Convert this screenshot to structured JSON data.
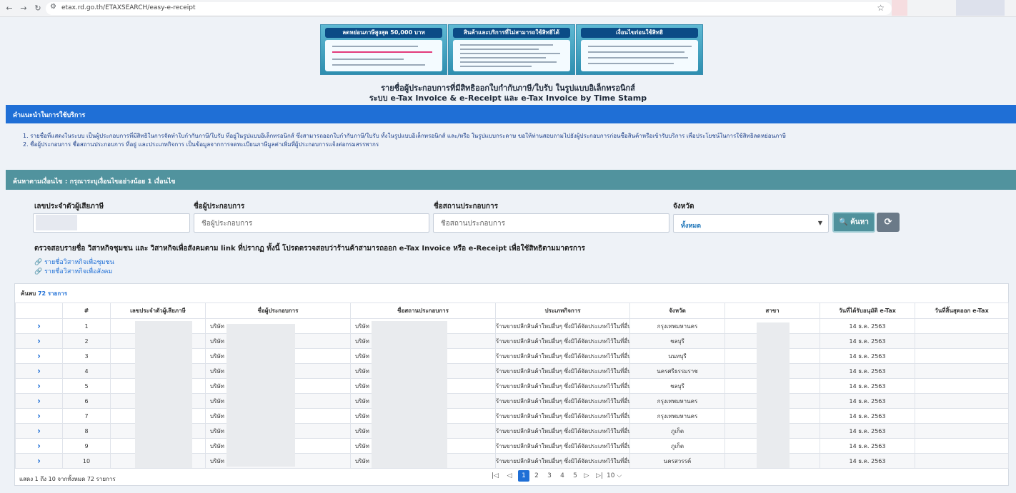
{
  "browser": {
    "url": "etax.rd.go.th/ETAXSEARCH/easy-e-receipt"
  },
  "banners": [
    {
      "title": "ลดหย่อนภาษีสูงสุด 50,000 บาท"
    },
    {
      "title": "สินค้าและบริการที่ไม่สามารถใช้สิทธิได้"
    },
    {
      "title": "เงื่อนไขก่อนใช้สิทธิ"
    }
  ],
  "headline": {
    "line1": "รายชื่อผู้ประกอบการที่มีสิทธิออกใบกำกับภาษี/ใบรับ ในรูปแบบอิเล็กทรอนิกส์",
    "line2": "ระบบ e-Tax Invoice & e-Receipt และ e-Tax Invoice by Time Stamp"
  },
  "info": {
    "heading": "คำแนะนำในการใช้บริการ",
    "item1": "1. รายชื่อที่แสดงในระบบ เป็นผู้ประกอบการที่มีสิทธิในการจัดทำใบกำกับภาษี/ใบรับ ที่อยู่ในรูปแบบอิเล็กทรอนิกส์ ซึ่งสามารถออกใบกำกับภาษี/ใบรับ ทั้งในรูปแบบอิเล็กทรอนิกส์ และ/หรือ ในรูปแบบกระดาษ ขอให้ท่านสอบถามไปยังผู้ประกอบการก่อนซื้อสินค้าหรือเข้ารับบริการ เพื่อประโยชน์ในการใช้สิทธิลดหย่อนภาษี",
    "item2": "2. ชื่อผู้ประกอบการ ชื่อสถานประกอบการ ที่อยู่ และประเภทกิจการ เป็นข้อมูลจากการจดทะเบียนภาษีมูลค่าเพิ่มที่ผู้ประกอบการแจ้งต่อกรมสรรพากร"
  },
  "search": {
    "heading": "ค้นหาตามเงื่อนไข : กรุณาระบุเงื่อนไขอย่างน้อย 1 เงื่อนไข",
    "tax_id_label": "เลขประจำตัวผู้เสียภาษี",
    "operator_label": "ชื่อผู้ประกอบการ",
    "operator_placeholder": "ชื่อผู้ประกอบการ",
    "branch_label": "ชื่อสถานประกอบการ",
    "branch_placeholder": "ชื่อสถานประกอบการ",
    "province_label": "จังหวัด",
    "province_value": "ทั้งหมด",
    "search_button": "ค้นหา",
    "search_icon": "search-icon",
    "reset_icon": "refresh-icon",
    "note": "ตรวจสอบรายชื่อ วิสาหกิจชุมชน และ วิสาหกิจเพื่อสังคมตาม link ที่ปรากฏ ทั้งนี้ โปรดตรวจสอบว่าร้านค้าสามารถออก e-Tax Invoice หรือ e-Receipt เพื่อใช้สิทธิตามมาตรการ",
    "link1": "รายชื่อวิสาหกิจเพื่อชุมชน",
    "link2": "รายชื่อวิสาหกิจเพื่อสังคม"
  },
  "results": {
    "found_prefix": "ค้นพบ",
    "found_count": "72 รายการ",
    "columns": [
      "",
      "#",
      "เลขประจำตัวผู้เสียภาษี",
      "ชื่อผู้ประกอบการ",
      "ชื่อสถานประกอบการ",
      "ประเภทกิจการ",
      "จังหวัด",
      "สาขา",
      "วันที่ได้รับอนุมัติ e-Tax",
      "วันที่สิ้นสุดออก e-Tax"
    ],
    "rows": [
      {
        "n": "1",
        "op": "บริษัท",
        "br": "บริษัท",
        "type": "ร้านขายปลีกสินค้าใหม่อื่นๆ ซึ่งมิได้จัดประเภทไว้ในที่อื่น",
        "prov": "กรุงเทพมหานคร",
        "date": "14 ธ.ค. 2563"
      },
      {
        "n": "2",
        "op": "บริษัท",
        "br": "บริษัท",
        "type": "ร้านขายปลีกสินค้าใหม่อื่นๆ ซึ่งมิได้จัดประเภทไว้ในที่อื่น",
        "prov": "ชลบุรี",
        "date": "14 ธ.ค. 2563"
      },
      {
        "n": "3",
        "op": "บริษัท",
        "br": "บริษัท",
        "type": "ร้านขายปลีกสินค้าใหม่อื่นๆ ซึ่งมิได้จัดประเภทไว้ในที่อื่น",
        "prov": "นนทบุรี",
        "date": "14 ธ.ค. 2563"
      },
      {
        "n": "4",
        "op": "บริษัท",
        "br": "บริษัท",
        "type": "ร้านขายปลีกสินค้าใหม่อื่นๆ ซึ่งมิได้จัดประเภทไว้ในที่อื่น",
        "prov": "นครศรีธรรมราช",
        "date": "14 ธ.ค. 2563"
      },
      {
        "n": "5",
        "op": "บริษัท",
        "br": "บริษัท",
        "type": "ร้านขายปลีกสินค้าใหม่อื่นๆ ซึ่งมิได้จัดประเภทไว้ในที่อื่น",
        "prov": "ชลบุรี",
        "date": "14 ธ.ค. 2563"
      },
      {
        "n": "6",
        "op": "บริษัท",
        "br": "บริษัท",
        "type": "ร้านขายปลีกสินค้าใหม่อื่นๆ ซึ่งมิได้จัดประเภทไว้ในที่อื่น",
        "prov": "กรุงเทพมหานคร",
        "date": "14 ธ.ค. 2563"
      },
      {
        "n": "7",
        "op": "บริษัท",
        "br": "บริษัท",
        "type": "ร้านขายปลีกสินค้าใหม่อื่นๆ ซึ่งมิได้จัดประเภทไว้ในที่อื่น",
        "prov": "กรุงเทพมหานคร",
        "date": "14 ธ.ค. 2563"
      },
      {
        "n": "8",
        "op": "บริษัท",
        "br": "บริษัท",
        "type": "ร้านขายปลีกสินค้าใหม่อื่นๆ ซึ่งมิได้จัดประเภทไว้ในที่อื่น",
        "prov": "ภูเก็ต",
        "date": "14 ธ.ค. 2563"
      },
      {
        "n": "9",
        "op": "บริษัท",
        "br": "บริษัท",
        "type": "ร้านขายปลีกสินค้าใหม่อื่นๆ ซึ่งมิได้จัดประเภทไว้ในที่อื่น",
        "prov": "ภูเก็ต",
        "date": "14 ธ.ค. 2563"
      },
      {
        "n": "10",
        "op": "บริษัท",
        "br": "บริษัท",
        "type": "ร้านขายปลีกสินค้าใหม่อื่นๆ ซึ่งมิได้จัดประเภทไว้ในที่อื่น",
        "prov": "นครสวรรค์",
        "date": "14 ธ.ค. 2563"
      }
    ],
    "footer": "แสดง 1 ถึง 10 จากทั้งหมด 72 รายการ",
    "pages": [
      "1",
      "2",
      "3",
      "4",
      "5"
    ],
    "active_page": "1",
    "page_size": "10"
  },
  "colors": {
    "info_blue": "#1f6fd6",
    "search_teal": "#51939e",
    "reset_gray": "#6b7a88"
  }
}
